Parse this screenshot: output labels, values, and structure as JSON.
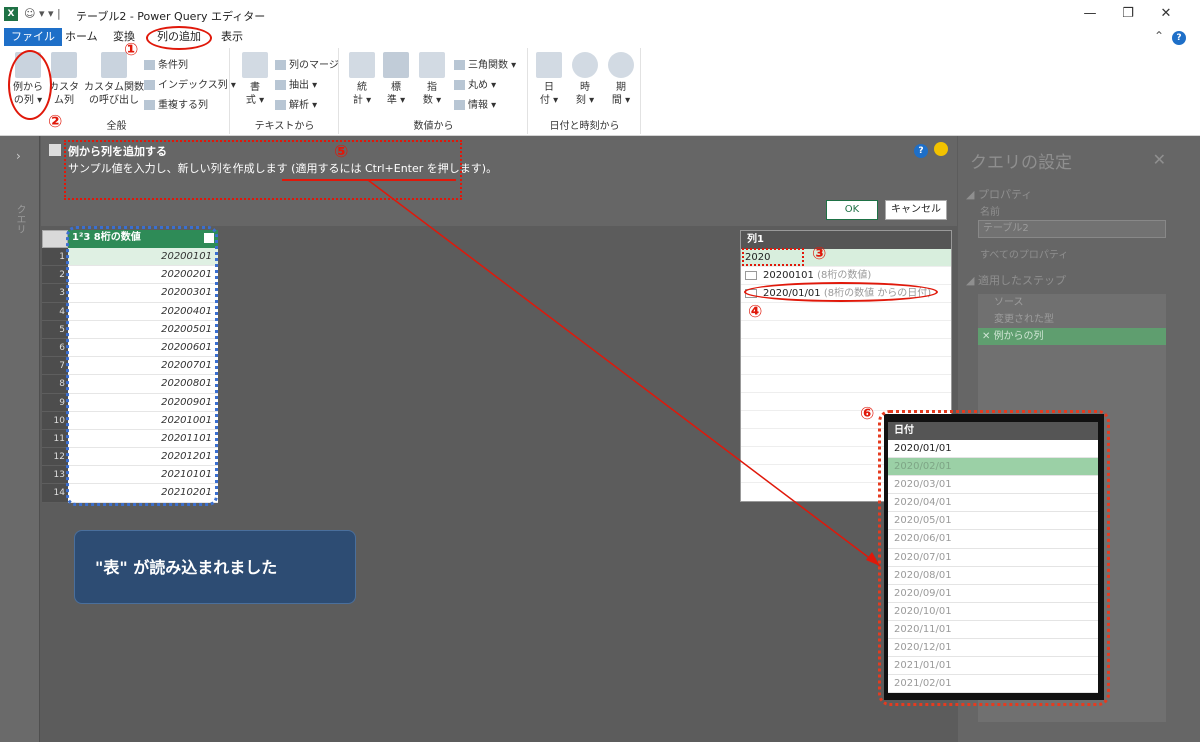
{
  "window": {
    "app_icon": "X",
    "qat": "☺ ▾ ▾ |",
    "title": "テーブル2 - Power Query エディター",
    "minimize": "—",
    "restore": "❐",
    "close": "✕"
  },
  "tabs": [
    {
      "label": "ファイル"
    },
    {
      "label": "ホーム"
    },
    {
      "label": "変換"
    },
    {
      "label": "列の追加"
    },
    {
      "label": "表示"
    }
  ],
  "ribbon": {
    "group_general": {
      "label": "全般",
      "col_from_example": [
        "例から",
        "の列 ▾"
      ],
      "custom_col": [
        "カスタ",
        "ム列"
      ],
      "invoke_custom_func": [
        "カスタム関数",
        "の呼び出し"
      ],
      "conditional_col": "条件列",
      "index_col": "インデックス列 ▾",
      "duplicate_col": "重複する列"
    },
    "group_text": {
      "label": "テキストから",
      "format": [
        "書",
        "式 ▾"
      ],
      "merge_cols": "列のマージ",
      "extract": "抽出 ▾",
      "parse": "解析 ▾"
    },
    "group_number": {
      "label": "数値から",
      "statistics": [
        "統",
        "計 ▾"
      ],
      "standard": [
        "標",
        "準 ▾"
      ],
      "scientific": [
        "指",
        "数 ▾"
      ],
      "trig": "三角関数 ▾",
      "rounding": "丸め ▾",
      "info": "情報 ▾"
    },
    "group_datetime": {
      "label": "日付と時刻から",
      "date": [
        "日",
        "付 ▾"
      ],
      "time": [
        "時",
        "刻 ▾"
      ],
      "duration": [
        "期",
        "間 ▾"
      ]
    }
  },
  "banner": {
    "title": "例から列を追加する",
    "desc_prefix": "サンプル値を入力し、新しい列を作成します (",
    "desc_keys": "適用するには Ctrl+Enter を押します",
    "desc_suffix": ")。",
    "help": "?",
    "ok": "OK",
    "cancel": "キャンセル"
  },
  "query_pane": {
    "label": "クエリ",
    "expand": "›"
  },
  "grid": {
    "header": "8桁の数値",
    "type_icon": "1²3",
    "rows": [
      {
        "n": "1",
        "v": "20200101"
      },
      {
        "n": "2",
        "v": "20200201"
      },
      {
        "n": "3",
        "v": "20200301"
      },
      {
        "n": "4",
        "v": "20200401"
      },
      {
        "n": "5",
        "v": "20200501"
      },
      {
        "n": "6",
        "v": "20200601"
      },
      {
        "n": "7",
        "v": "20200701"
      },
      {
        "n": "8",
        "v": "20200801"
      },
      {
        "n": "9",
        "v": "20200901"
      },
      {
        "n": "10",
        "v": "20201001"
      },
      {
        "n": "11",
        "v": "20201101"
      },
      {
        "n": "12",
        "v": "20201201"
      },
      {
        "n": "13",
        "v": "20210101"
      },
      {
        "n": "14",
        "v": "20210201"
      }
    ]
  },
  "new_column": {
    "header": "列1",
    "input_value": "2020",
    "suggestions": [
      {
        "value": "20200101",
        "hint": "(8桁の数値)"
      },
      {
        "value": "2020/01/01",
        "hint": "(8桁の数値 からの日付)"
      }
    ]
  },
  "settings": {
    "title": "クエリの設定",
    "close": "✕",
    "properties": "◢ プロパティ",
    "name_label": "名前",
    "name_value": "テーブル2",
    "all_props": "すべてのプロパティ",
    "applied_steps": "◢ 適用したステップ",
    "steps": [
      "ソース",
      "変更された型",
      "例からの列"
    ]
  },
  "zoom": {
    "header": "日付",
    "rows": [
      "2020/01/01",
      "2020/02/01",
      "2020/03/01",
      "2020/04/01",
      "2020/05/01",
      "2020/06/01",
      "2020/07/01",
      "2020/08/01",
      "2020/09/01",
      "2020/10/01",
      "2020/11/01",
      "2020/12/01",
      "2021/01/01",
      "2021/02/01"
    ]
  },
  "callout": "\"表\" が読み込まれました",
  "annotations": [
    "①",
    "②",
    "③",
    "④",
    "⑤",
    "⑥"
  ],
  "colors": {
    "accent": "#1e6fc8",
    "excel_green": "#1e7145",
    "annotation_red": "#e0180a",
    "highlight_blue": "#3b6fd0"
  }
}
